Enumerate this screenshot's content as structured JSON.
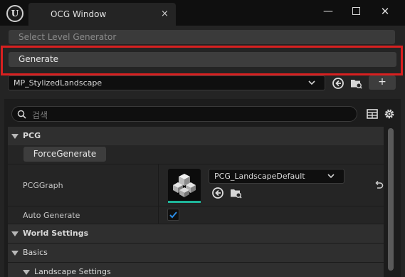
{
  "window": {
    "tab_title": "OCG Window",
    "tab_close": "×",
    "minimize": "—",
    "close": "✕",
    "logo_letter": "U"
  },
  "toolbar": {
    "select_level_label": "Select Level Generator",
    "generate_label": "Generate",
    "asset_value": "MP_StylizedLandscape",
    "add_label": "+"
  },
  "search": {
    "placeholder": "검색"
  },
  "details": {
    "pcg_category": "PCG",
    "force_generate_label": "ForceGenerate",
    "pcg_graph_label": "PCGGraph",
    "pcg_graph_value": "PCG_LandscapeDefault",
    "auto_generate_label": "Auto Generate",
    "auto_generate_checked": true,
    "world_settings_category": "World Settings",
    "basics_category": "Basics",
    "landscape_settings_category": "Landscape Settings"
  },
  "colors": {
    "highlight_border": "#d92020",
    "checkbox_check": "#2a8ce6",
    "thumbnail_accent": "#1fb59a"
  }
}
